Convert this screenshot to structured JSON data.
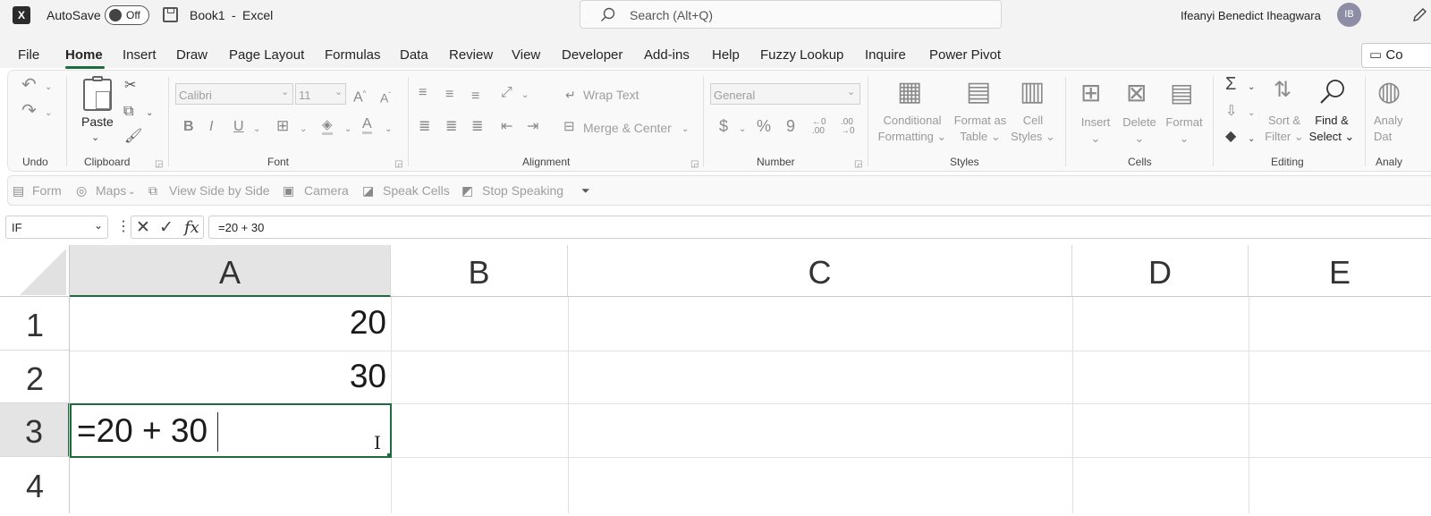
{
  "titlebar": {
    "autosave_label": "AutoSave",
    "autosave_state": "Off",
    "doc_title": "Book1",
    "separator": "-",
    "app_name": "Excel",
    "search_placeholder": "Search (Alt+Q)",
    "user_name": "Ifeanyi Benedict Iheagwara",
    "user_initials": "IB"
  },
  "menu": [
    "File",
    "Home",
    "Insert",
    "Draw",
    "Page Layout",
    "Formulas",
    "Data",
    "Review",
    "View",
    "Developer",
    "Add-ins",
    "Help",
    "Fuzzy Lookup",
    "Inquire",
    "Power Pivot"
  ],
  "menu_right": "Co",
  "ribbon": {
    "groups": {
      "undo": "Undo",
      "clipboard": "Clipboard",
      "font": "Font",
      "alignment": "Alignment",
      "number": "Number",
      "styles": "Styles",
      "cells": "Cells",
      "editing": "Editing",
      "analysis": "Analy"
    },
    "paste": "Paste",
    "font_name": "Calibri",
    "font_size": "11",
    "wrap_text": "Wrap Text",
    "merge_center": "Merge & Center",
    "number_format": "General",
    "cond_fmt_1": "Conditional",
    "cond_fmt_2": "Formatting",
    "fmt_table_1": "Format as",
    "fmt_table_2": "Table",
    "cell_styles_1": "Cell",
    "cell_styles_2": "Styles",
    "insert": "Insert",
    "delete": "Delete",
    "format": "Format",
    "sort_1": "Sort &",
    "sort_2": "Filter",
    "find_1": "Find &",
    "find_2": "Select",
    "analyze_1": "Analy",
    "analyze_2": "Dat"
  },
  "qat": [
    "Form",
    "Maps",
    "View Side by Side",
    "Camera",
    "Speak Cells",
    "Stop Speaking"
  ],
  "formula_bar": {
    "name_box": "IF",
    "formula": "=20 + 30",
    "fx": "fx"
  },
  "sheet": {
    "columns": [
      "A",
      "B",
      "C",
      "D",
      "E"
    ],
    "rows": [
      "1",
      "2",
      "3",
      "4"
    ],
    "cells": {
      "A1": "20",
      "A2": "30",
      "A3": "=20 + 30"
    }
  }
}
